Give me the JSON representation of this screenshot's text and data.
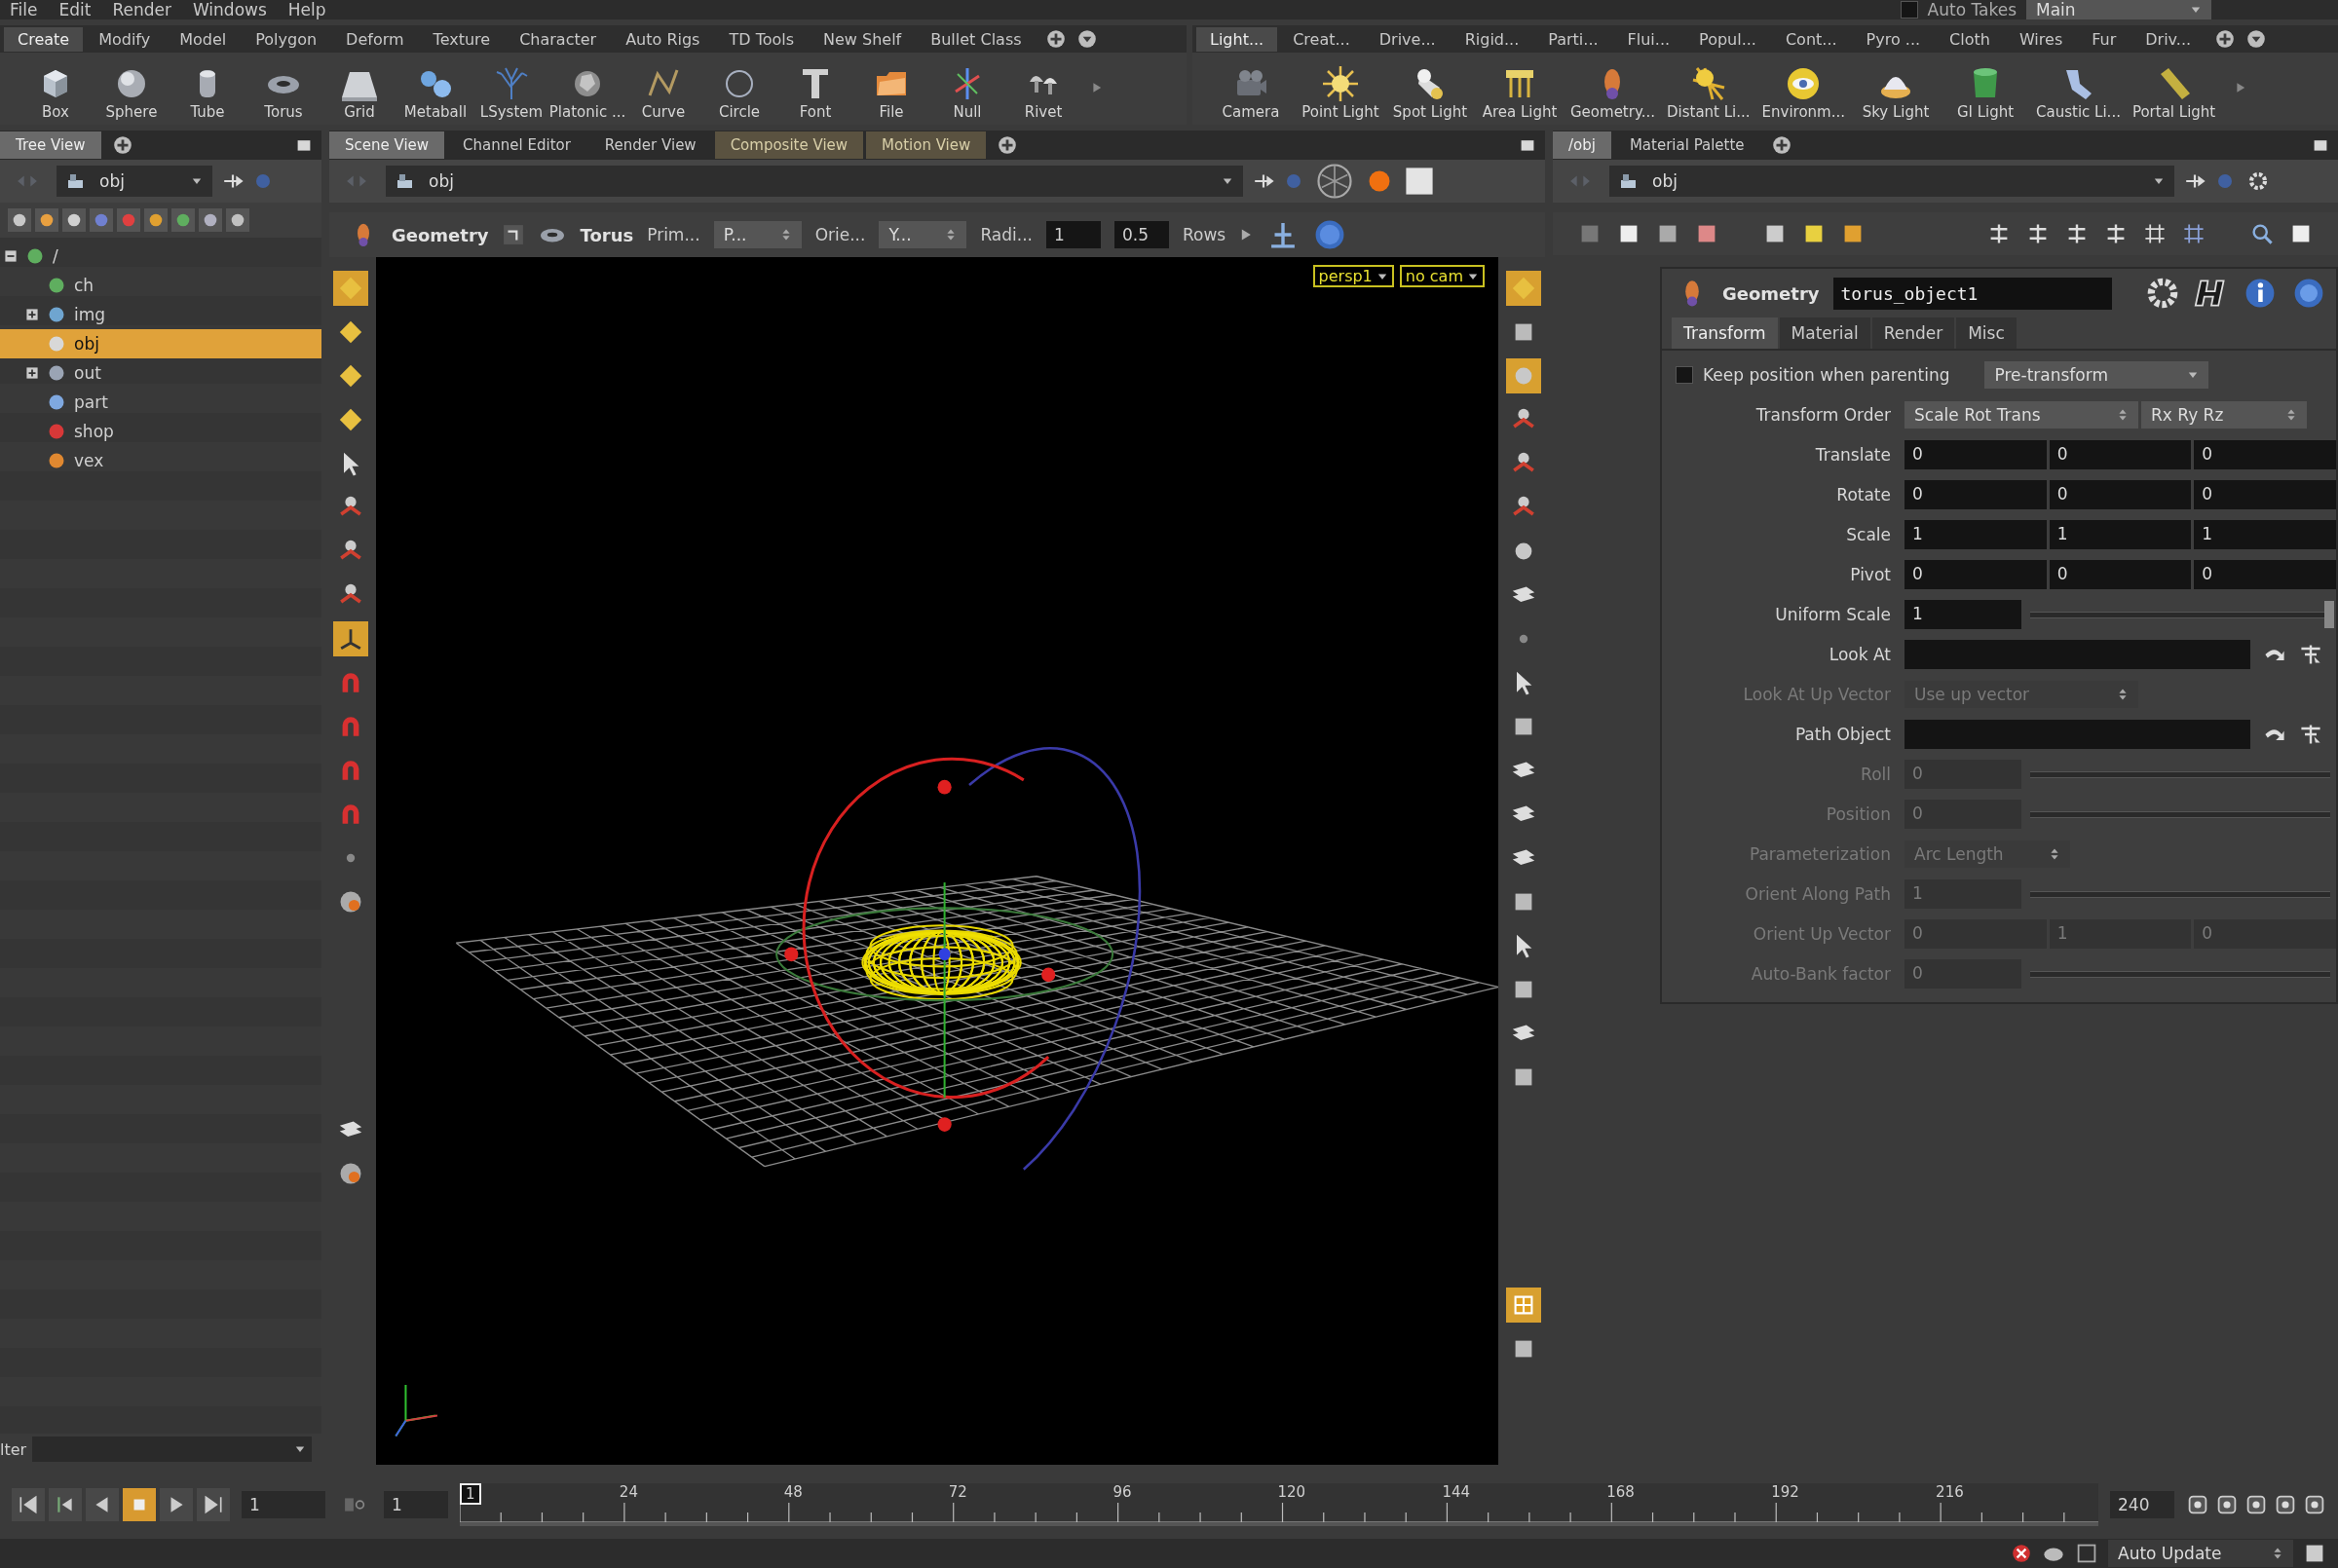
{
  "menu_bar": {
    "items": [
      "File",
      "Edit",
      "Render",
      "Windows",
      "Help"
    ],
    "auto_takes": {
      "label": "Auto Takes",
      "checked": false
    },
    "take": "Main"
  },
  "shelves": [
    {
      "tabs": [
        {
          "label": "Create",
          "selected": true
        },
        {
          "label": "Modify",
          "selected": false
        },
        {
          "label": "Model",
          "selected": false
        },
        {
          "label": "Polygon",
          "selected": false
        },
        {
          "label": "Deform",
          "selected": false
        },
        {
          "label": "Texture",
          "selected": false
        },
        {
          "label": "Character",
          "selected": false
        },
        {
          "label": "Auto Rigs",
          "selected": false
        },
        {
          "label": "TD Tools",
          "selected": false
        },
        {
          "label": "New Shelf",
          "selected": false
        },
        {
          "label": "Bullet Class",
          "selected": false
        }
      ],
      "tools": [
        "Box",
        "Sphere",
        "Tube",
        "Torus",
        "Grid",
        "Metaball",
        "LSystem",
        "Platonic ...",
        "Curve",
        "Circle",
        "Font",
        "File",
        "Null",
        "Rivet"
      ]
    },
    {
      "tabs": [
        {
          "label": "Light...",
          "selected": true
        },
        {
          "label": "Creat...",
          "selected": false
        },
        {
          "label": "Drive...",
          "selected": false
        },
        {
          "label": "Rigid...",
          "selected": false
        },
        {
          "label": "Parti...",
          "selected": false
        },
        {
          "label": "Flui...",
          "selected": false
        },
        {
          "label": "Popul...",
          "selected": false
        },
        {
          "label": "Cont...",
          "selected": false
        },
        {
          "label": "Pyro ...",
          "selected": false
        },
        {
          "label": "Cloth",
          "selected": false
        },
        {
          "label": "Wires",
          "selected": false
        },
        {
          "label": "Fur",
          "selected": false
        },
        {
          "label": "Driv...",
          "selected": false
        }
      ],
      "tools": [
        "Camera",
        "Point Light",
        "Spot Light",
        "Area Light",
        "Geometry...",
        "Distant Li...",
        "Environm...",
        "Sky Light",
        "GI Light",
        "Caustic Li...",
        "Portal Light"
      ]
    }
  ],
  "tree_view": {
    "tab": "Tree View",
    "path": "obj",
    "filter_label": "lter",
    "tree": [
      {
        "label": "/",
        "expanded": true,
        "selected": false,
        "children": [
          {
            "label": "ch",
            "selected": false
          },
          {
            "label": "img",
            "expanded": false,
            "selected": false
          },
          {
            "label": "obj",
            "selected": true
          },
          {
            "label": "out",
            "expanded": false,
            "selected": false
          },
          {
            "label": "part",
            "selected": false
          },
          {
            "label": "shop",
            "selected": false
          },
          {
            "label": "vex",
            "selected": false
          }
        ]
      }
    ]
  },
  "scene_view": {
    "tabs": [
      {
        "label": "Scene View",
        "selected": true
      },
      {
        "label": "Channel Editor",
        "selected": false
      },
      {
        "label": "Render View",
        "selected": false
      },
      {
        "label": "Composite View",
        "selected": false
      },
      {
        "label": "Motion View",
        "selected": false
      }
    ],
    "path": "obj",
    "operation": {
      "node_type": "Geometry",
      "tool": "Torus",
      "fields": [
        {
          "kind": "label",
          "text": "Prim..."
        },
        {
          "kind": "menu",
          "text": "P..."
        },
        {
          "kind": "label",
          "text": "Orie..."
        },
        {
          "kind": "menu",
          "text": "Y..."
        },
        {
          "kind": "label",
          "text": "Radi..."
        },
        {
          "kind": "field",
          "text": "1"
        },
        {
          "kind": "field",
          "text": "0.5"
        },
        {
          "kind": "label",
          "text": "Rows"
        }
      ]
    },
    "camera_menus": [
      "persp1",
      "no cam"
    ]
  },
  "parameters": {
    "tabs": [
      {
        "label": "/obj",
        "selected": true
      },
      {
        "label": "Material Palette",
        "selected": false
      }
    ],
    "path": "obj",
    "node_type": "Geometry",
    "node_name": "torus_object1",
    "param_tabs": [
      {
        "label": "Transform",
        "selected": true
      },
      {
        "label": "Material",
        "selected": false
      },
      {
        "label": "Render",
        "selected": false
      },
      {
        "label": "Misc",
        "selected": false
      }
    ],
    "rows": [
      {
        "kind": "toggle",
        "label": "Keep position when parenting",
        "checked": false,
        "menu": "Pre-transform",
        "disabled": false
      },
      {
        "kind": "menus",
        "label": "Transform Order",
        "menus": [
          "Scale Rot Trans",
          "Rx Ry Rz"
        ],
        "disabled": false
      },
      {
        "kind": "vector",
        "label": "Translate",
        "values": [
          "0",
          "0",
          "0"
        ],
        "disabled": false
      },
      {
        "kind": "vector",
        "label": "Rotate",
        "values": [
          "0",
          "0",
          "0"
        ],
        "disabled": false
      },
      {
        "kind": "vector",
        "label": "Scale",
        "values": [
          "1",
          "1",
          "1"
        ],
        "disabled": false
      },
      {
        "kind": "vector",
        "label": "Pivot",
        "values": [
          "0",
          "0",
          "0"
        ],
        "disabled": false
      },
      {
        "kind": "slider",
        "label": "Uniform Scale",
        "value": "1",
        "level": 1,
        "disabled": false
      },
      {
        "kind": "path",
        "label": "Look At",
        "disabled": false
      },
      {
        "kind": "menu",
        "label": "Look At Up Vector",
        "menu": "Use up vector",
        "disabled": true
      },
      {
        "kind": "path",
        "label": "Path Object",
        "disabled": false
      },
      {
        "kind": "slider",
        "label": "Roll",
        "value": "0",
        "disabled": true
      },
      {
        "kind": "slider",
        "label": "Position",
        "value": "0",
        "disabled": true
      },
      {
        "kind": "menu",
        "label": "Parameterization",
        "menu": "Arc Length",
        "disabled": true
      },
      {
        "kind": "slider",
        "label": "Orient Along Path",
        "value": "1",
        "disabled": true
      },
      {
        "kind": "vector",
        "label": "Orient Up Vector",
        "values": [
          "0",
          "1",
          "0"
        ],
        "disabled": true
      },
      {
        "kind": "slider",
        "label": "Auto-Bank factor",
        "value": "0",
        "disabled": true
      }
    ]
  },
  "playbar": {
    "start_frame": "1",
    "current_frame": "1",
    "frame_marker": "1",
    "end_frame": "240",
    "ticks": [
      "24",
      "48",
      "72",
      "96",
      "120",
      "144",
      "168",
      "192",
      "216"
    ]
  },
  "status_bar": {
    "update_mode": "Auto Update"
  }
}
